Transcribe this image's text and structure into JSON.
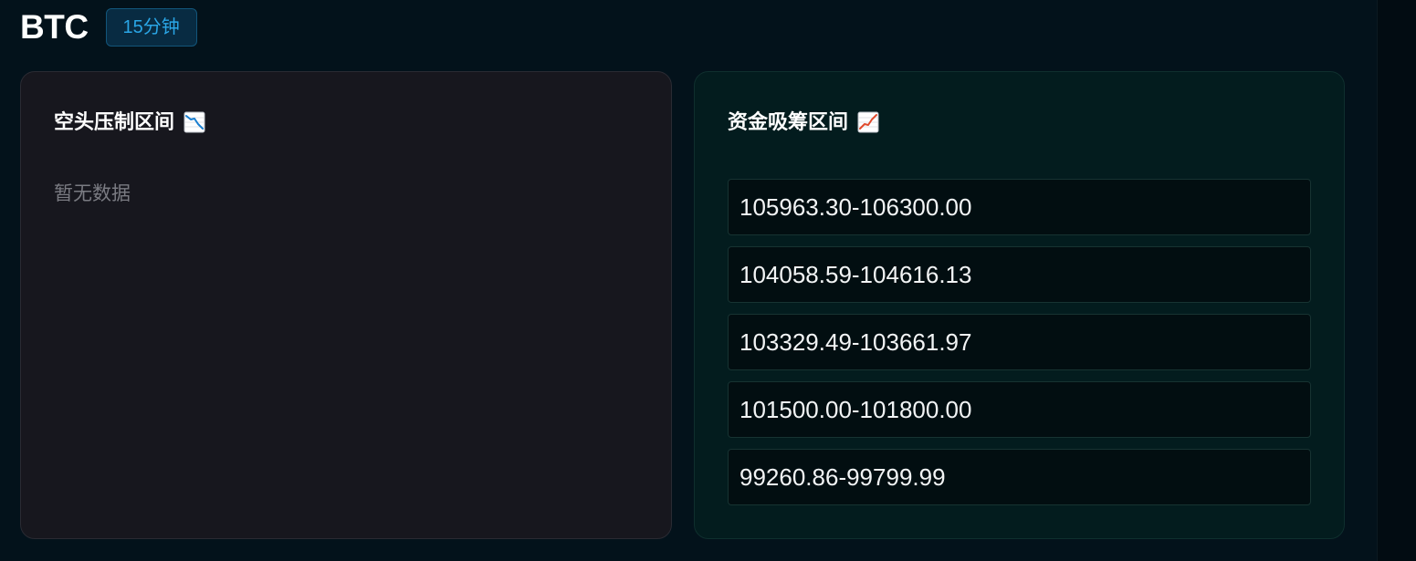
{
  "header": {
    "symbol": "BTC",
    "interval": "15分钟"
  },
  "short_panel": {
    "title": "空头压制区间",
    "icon": "chart-decreasing-icon",
    "empty_text": "暂无数据"
  },
  "long_panel": {
    "title": "资金吸筹区间",
    "icon": "chart-increasing-icon",
    "ranges": [
      "105963.30-106300.00",
      "104058.59-104616.13",
      "103329.49-103661.97",
      "101500.00-101800.00",
      "99260.86-99799.99"
    ]
  },
  "colors": {
    "accent": "#2aa6e6",
    "short_card_bg": "#17171e",
    "long_card_bg": "#031c1e",
    "page_bg": "#03121b"
  }
}
